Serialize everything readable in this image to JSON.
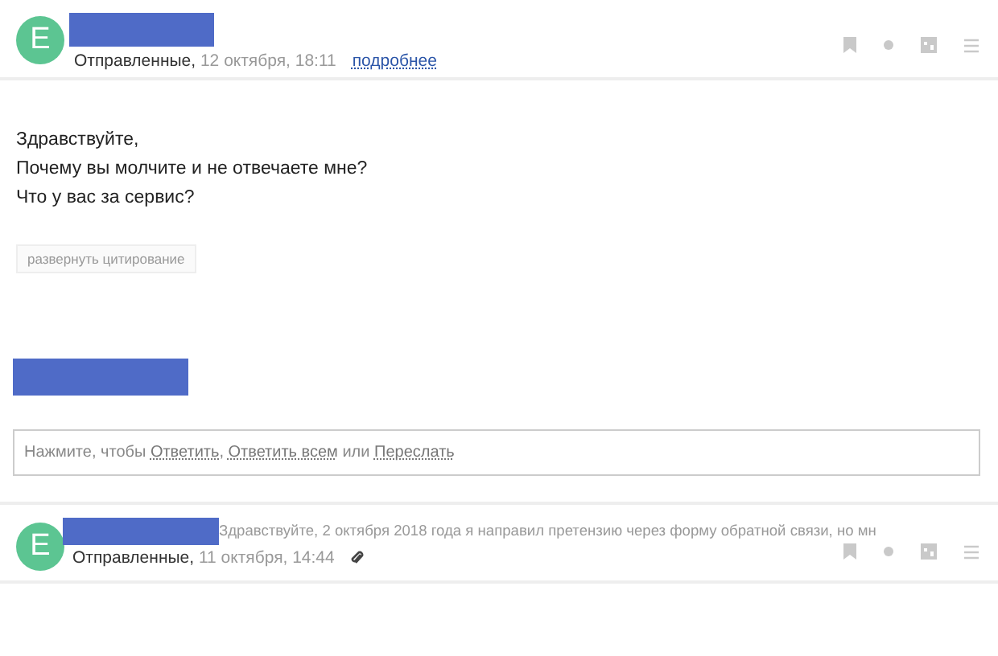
{
  "messages": [
    {
      "avatar": "E",
      "folder": "Отправленные,",
      "date": "12 октября, 18:11",
      "details_link": "подробнее",
      "body": [
        "Здравствуйте,",
        "Почему вы молчите и не отвечаете мне?",
        "Что у вас за сервис?"
      ],
      "expand_quote_button": "развернуть цитирование"
    },
    {
      "avatar": "E",
      "folder": "Отправленные,",
      "date": "11 октября, 14:44",
      "preview": "Здравствуйте, 2 октября 2018 года я направил претензию через форму обратной связи, но мн",
      "has_attachment": true
    }
  ],
  "reply": {
    "prompt": [
      {
        "kind": "text",
        "text": "Нажмите, чтобы "
      },
      {
        "kind": "link",
        "text": "Ответить"
      },
      {
        "kind": "text",
        "text": ", "
      },
      {
        "kind": "link",
        "text": "Ответить всем"
      },
      {
        "kind": "text",
        "text": " или "
      },
      {
        "kind": "link",
        "text": "Переслать"
      }
    ]
  }
}
